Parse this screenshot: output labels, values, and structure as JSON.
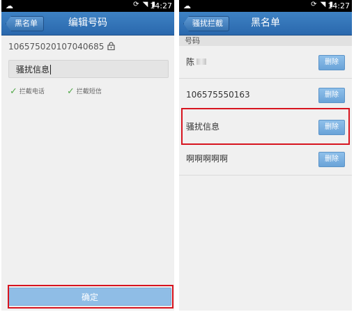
{
  "left_screen": {
    "status_bar": {
      "time": "14:27"
    },
    "back_label": "黑名单",
    "title": "编辑号码",
    "phone_number": "106575020107040685",
    "keyword_value": "骚扰信息",
    "options": [
      {
        "label": "拦截电话",
        "checked": true
      },
      {
        "label": "拦截短信",
        "checked": true
      }
    ],
    "confirm_label": "确定"
  },
  "right_screen": {
    "status_bar": {
      "time": "14:27"
    },
    "back_label": "骚扰拦截",
    "title": "黑名单",
    "section_header": "号码",
    "entries": [
      {
        "label": "陈",
        "action": "删除"
      },
      {
        "label": "106575550163",
        "action": "删除"
      },
      {
        "label": "骚扰信息",
        "action": "删除"
      },
      {
        "label": "啊啊啊啊啊",
        "action": "删除"
      }
    ]
  },
  "colors": {
    "titlebar": "#2f73b8",
    "highlight": "#d7141f",
    "delete_button": "#7bb1df",
    "check": "#53a94a"
  },
  "icons": [
    "app-notification-icon",
    "wifi-icon",
    "signal-icon",
    "battery-icon",
    "lock-icon",
    "check-icon"
  ]
}
